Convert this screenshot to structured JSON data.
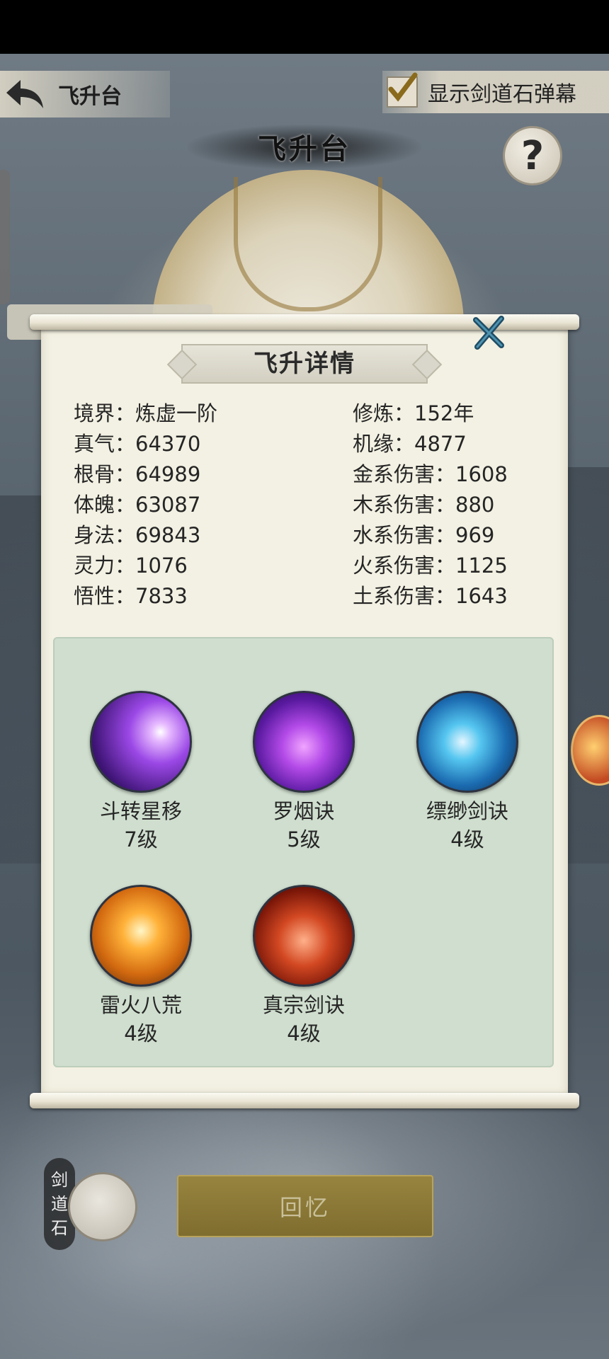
{
  "header": {
    "back_label": "飞升台",
    "toggle_label": "显示剑道石弹幕",
    "toggle_checked": true,
    "page_title": "飞升台",
    "help_symbol": "?"
  },
  "dialog": {
    "title": "飞升详情",
    "stats_left": [
      {
        "label": "境界：",
        "value": "炼虚一阶"
      },
      {
        "label": "真气：",
        "value": "64370"
      },
      {
        "label": "根骨：",
        "value": "64989"
      },
      {
        "label": "体魄：",
        "value": "63087"
      },
      {
        "label": "身法：",
        "value": "69843"
      },
      {
        "label": "灵力：",
        "value": "1076"
      },
      {
        "label": "悟性：",
        "value": "7833"
      }
    ],
    "stats_right": [
      {
        "label": "修炼：",
        "value": "152年"
      },
      {
        "label": "机缘：",
        "value": "4877"
      },
      {
        "label": "金系伤害：",
        "value": "1608"
      },
      {
        "label": "木系伤害：",
        "value": "880"
      },
      {
        "label": "水系伤害：",
        "value": "969"
      },
      {
        "label": "火系伤害：",
        "value": "1125"
      },
      {
        "label": "土系伤害：",
        "value": "1643"
      }
    ],
    "skills": [
      {
        "name": "斗转星移",
        "level": "7级",
        "icon": "star-shift-skill-icon"
      },
      {
        "name": "罗烟诀",
        "level": "5级",
        "icon": "luo-yan-skill-icon"
      },
      {
        "name": "缥缈剑诀",
        "level": "4级",
        "icon": "piao-miao-sword-skill-icon"
      },
      {
        "name": "雷火八荒",
        "level": "4级",
        "icon": "thunder-fire-skill-icon"
      },
      {
        "name": "真宗剑诀",
        "level": "4级",
        "icon": "zhen-zong-sword-skill-icon"
      }
    ]
  },
  "bottom": {
    "sword_stone_label": [
      "剑",
      "道",
      "石"
    ],
    "recall_label": "回忆"
  },
  "colors": {
    "panel_bg": "#f3f1e3",
    "skills_bg": "#cfdece",
    "recall_button": "#8a7838",
    "close_x": "#2a5f78"
  }
}
